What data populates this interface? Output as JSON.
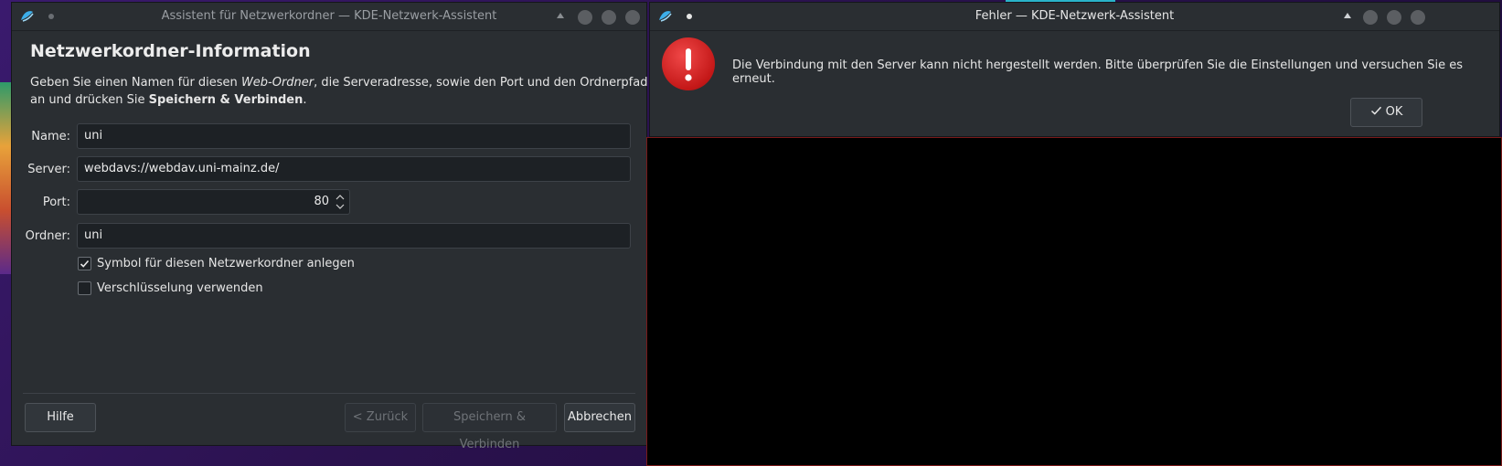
{
  "left_window": {
    "title": "Assistent für Netzwerkordner — KDE-Netzwerk-Assistent",
    "heading": "Netzwerkordner-Information",
    "description": {
      "part1": "Geben Sie einen Namen für diesen ",
      "italic": "Web-Ordner",
      "part2": ", die Serveradresse, sowie den Port und den Ordnerpfad an und drücken Sie ",
      "bold": "Speichern & Verbinden",
      "part3": "."
    },
    "fields": {
      "name_label": "Name:",
      "name_value": "uni",
      "server_label": "Server:",
      "server_value": "webdavs://webdav.uni-mainz.de/",
      "port_label": "Port:",
      "port_value": "80",
      "folder_label": "Ordner:",
      "folder_value": "uni"
    },
    "checkboxes": {
      "symbol_label": "Symbol für diesen Netzwerkordner anlegen",
      "symbol_checked": true,
      "encryption_label": "Verschlüsselung verwenden",
      "encryption_checked": false
    },
    "buttons": {
      "help": "Hilfe",
      "back": "< Zurück",
      "save_connect": "Speichern & Verbinden",
      "cancel": "Abbrechen"
    }
  },
  "error_window": {
    "title": "Fehler — KDE-Netzwerk-Assistent",
    "message": "Die Verbindung mit den Server kann nicht hergestellt werden. Bitte überprüfen Sie die Einstellungen und versuchen Sie es erneut.",
    "ok_label": "OK",
    "icon": "error-icon"
  },
  "colors": {
    "window_bg": "#2a2e32",
    "field_bg": "#1d2125",
    "error_red": "#d42020",
    "accent_blue": "#3daee9"
  }
}
